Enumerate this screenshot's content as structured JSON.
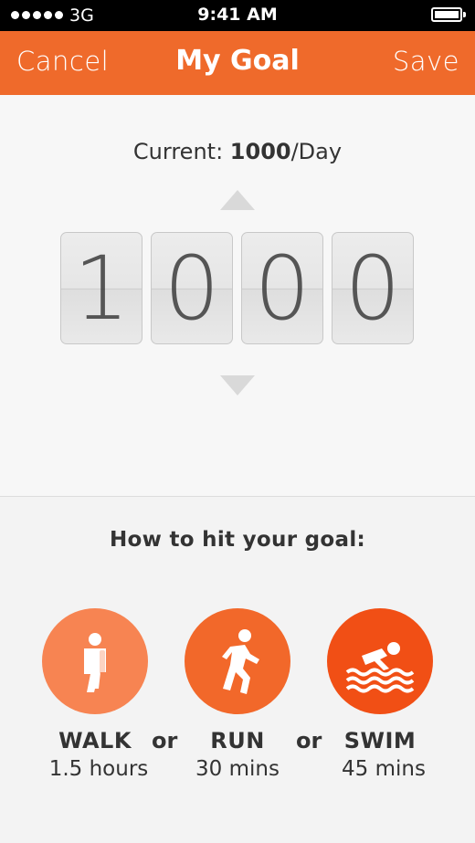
{
  "status_bar": {
    "carrier": "3G",
    "time": "9:41 AM",
    "signal_icon": "signal-dots-icon",
    "battery_icon": "battery-icon"
  },
  "nav": {
    "cancel_label": "Cancel",
    "title": "My Goal",
    "save_label": "Save"
  },
  "goal": {
    "current_prefix": "Current:",
    "current_value": "1000",
    "current_suffix": "/Day",
    "digits": [
      "1",
      "0",
      "0",
      "0"
    ],
    "increase_icon": "triangle-up-icon",
    "decrease_icon": "triangle-down-icon"
  },
  "howto": {
    "heading": "How to hit your goal:",
    "separator": "or",
    "activities": [
      {
        "name": "WALK",
        "duration": "1.5 hours",
        "icon": "walking-person-icon",
        "color": "#f78452"
      },
      {
        "name": "RUN",
        "duration": "30 mins",
        "icon": "running-person-icon",
        "color": "#f2682a"
      },
      {
        "name": "SWIM",
        "duration": "45 mins",
        "icon": "swimming-person-icon",
        "color": "#f14f15"
      }
    ]
  },
  "colors": {
    "accent": "#ef6a2b",
    "text": "#333333",
    "digit_text": "#555555"
  }
}
